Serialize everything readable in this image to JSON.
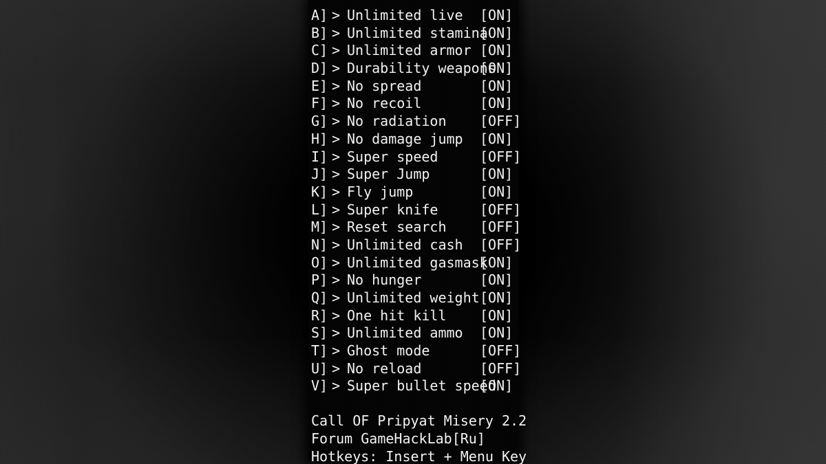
{
  "overlay": {
    "title_bar_absent": true,
    "panel_background": "#040404",
    "text_color": "#f2f2f2",
    "backdrop_color": "#1d1d1d"
  },
  "cheats": [
    {
      "key": "A]",
      "arrow": ">",
      "label": "Unlimited live",
      "status": "[ON]"
    },
    {
      "key": "B]",
      "arrow": ">",
      "label": "Unlimited stamina",
      "status": "[ON]"
    },
    {
      "key": "C]",
      "arrow": ">",
      "label": "Unlimited armor",
      "status": "[ON]"
    },
    {
      "key": "D]",
      "arrow": ">",
      "label": "Durability weapons",
      "status": "[ON]"
    },
    {
      "key": "E]",
      "arrow": ">",
      "label": "No spread",
      "status": "[ON]"
    },
    {
      "key": "F]",
      "arrow": ">",
      "label": "No recoil",
      "status": "[ON]"
    },
    {
      "key": "G]",
      "arrow": ">",
      "label": "No radiation",
      "status": "[OFF]"
    },
    {
      "key": "H]",
      "arrow": ">",
      "label": "No damage jump",
      "status": "[ON]"
    },
    {
      "key": "I]",
      "arrow": ">",
      "label": "Super speed",
      "status": "[OFF]"
    },
    {
      "key": "J]",
      "arrow": ">",
      "label": "Super Jump",
      "status": "[ON]"
    },
    {
      "key": "K]",
      "arrow": ">",
      "label": "Fly jump",
      "status": "[ON]"
    },
    {
      "key": "L]",
      "arrow": ">",
      "label": "Super knife",
      "status": "[OFF]"
    },
    {
      "key": "M]",
      "arrow": ">",
      "label": "Reset search",
      "status": "[OFF]"
    },
    {
      "key": "N]",
      "arrow": ">",
      "label": "Unlimited cash",
      "status": "[OFF]"
    },
    {
      "key": "O]",
      "arrow": ">",
      "label": "Unlimited gasmask",
      "status": "[ON]"
    },
    {
      "key": "P]",
      "arrow": ">",
      "label": "No hunger",
      "status": "[ON]"
    },
    {
      "key": "Q]",
      "arrow": ">",
      "label": "Unlimited weight",
      "status": "[ON]"
    },
    {
      "key": "R]",
      "arrow": ">",
      "label": "One hit kill",
      "status": "[ON]"
    },
    {
      "key": "S]",
      "arrow": ">",
      "label": "Unlimited ammo",
      "status": "[ON]"
    },
    {
      "key": "T]",
      "arrow": ">",
      "label": "Ghost mode",
      "status": "[OFF]"
    },
    {
      "key": "U]",
      "arrow": ">",
      "label": "No reload",
      "status": "[OFF]"
    },
    {
      "key": "V]",
      "arrow": ">",
      "label": "Super bullet speed",
      "status": "[ON]"
    }
  ],
  "footer": {
    "game_title": "Call OF Pripyat Misery 2.2",
    "forum": "Forum GameHackLab[Ru]",
    "hotkeys": "Hotkeys: Insert + Menu Key"
  }
}
